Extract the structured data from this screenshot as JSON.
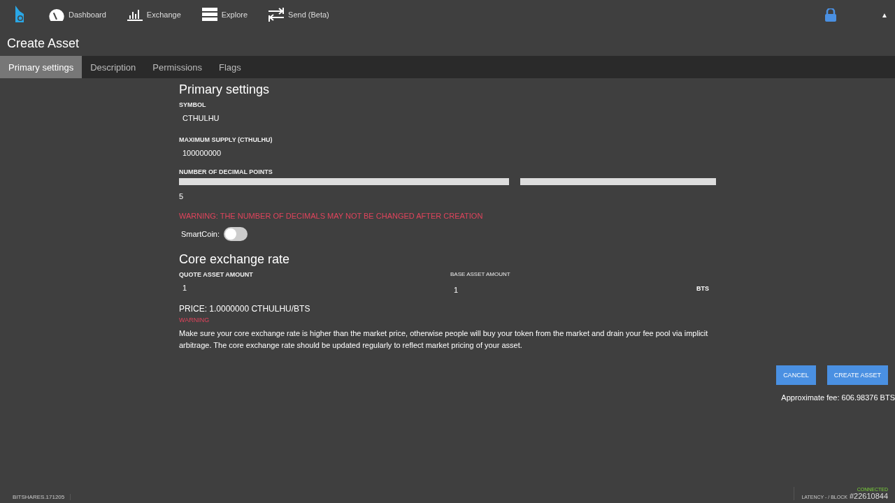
{
  "nav": [
    {
      "label": "Dashboard"
    },
    {
      "label": "Exchange"
    },
    {
      "label": "Explore"
    },
    {
      "label": "Send (Beta)"
    }
  ],
  "top_right": {
    "caret": "▲"
  },
  "page_title": "Create Asset",
  "tabs": [
    {
      "label": "Primary settings",
      "selected": true
    },
    {
      "label": "Description",
      "selected": false
    },
    {
      "label": "Permissions",
      "selected": false
    },
    {
      "label": "Flags",
      "selected": false
    }
  ],
  "section_title": "Primary settings",
  "symbol": {
    "label": "SYMBOL",
    "value": "CTHULHU"
  },
  "max_supply": {
    "label": "MAXIMUM SUPPLY (CTHULHU)",
    "value": "100000000"
  },
  "decimals": {
    "label": "NUMBER OF DECIMAL POINTS",
    "level": 0.625,
    "value": "5",
    "warning": "WARNING: THE NUMBER OF DECIMALS MAY NOT BE CHANGED AFTER CREATION"
  },
  "smartcoin": {
    "label": "SmartCoin:",
    "on": false
  },
  "core_rate": {
    "title": "Core exchange rate",
    "quote_label": "QUOTE ASSET AMOUNT",
    "quote_value": "1",
    "base_label": "BASE ASSET AMOUNT",
    "base_value": "1",
    "base_unit": "BTS",
    "price": "PRICE: 1.0000000 CTHULHU/BTS",
    "warning_title": "WARNING",
    "warning_text": "Make sure your core exchange rate is higher than the market price, otherwise people will buy your token from the market and drain your fee pool via implicit arbitrage. The core exchange rate should be updated regularly to reflect market pricing of your asset."
  },
  "buttons": [
    "CANCEL",
    "CREATE ASSET"
  ],
  "fee": "Approximate fee: 606.98376 BTS",
  "footer": {
    "version": "BITSHARES.171205",
    "status": "CONNECTED",
    "latency": "LATENCY - / BLOCK",
    "block": "#22610844"
  }
}
